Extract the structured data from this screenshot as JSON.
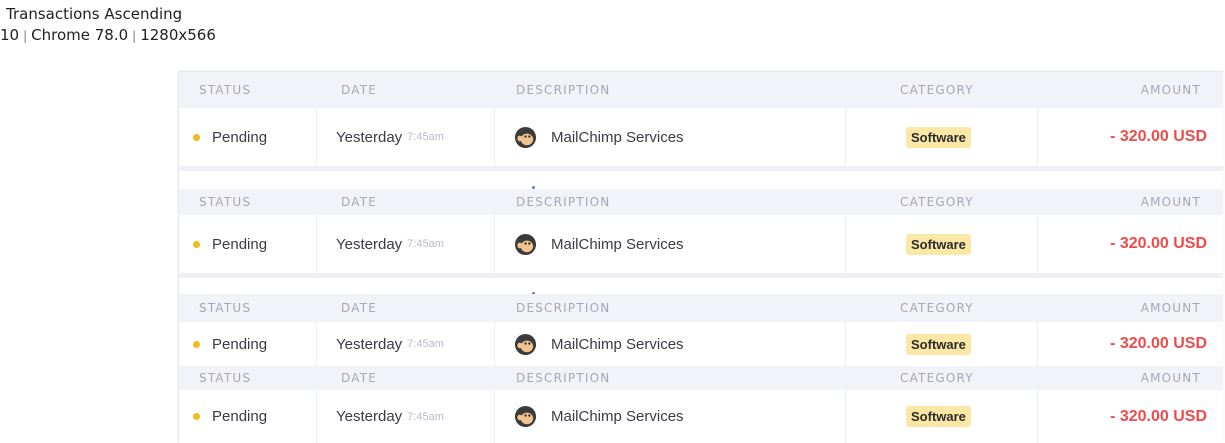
{
  "caption": {
    "title": "Transactions Ascending",
    "platform": "10",
    "browser": "Chrome 78.0",
    "resolution": "1280x566"
  },
  "columns": {
    "status": "STATUS",
    "date": "DATE",
    "description": "DESCRIPTION",
    "category": "CATEGORY",
    "amount": "AMOUNT"
  },
  "rows": [
    {
      "status": "Pending",
      "date": "Yesterday",
      "time": "7:45am",
      "description": "MailChimp Services",
      "category": "Software",
      "amount": "- 320.00 USD"
    },
    {
      "status": "Pending",
      "date": "Yesterday",
      "time": "7:45am",
      "description": "MailChimp Services",
      "category": "Software",
      "amount": "- 320.00 USD"
    },
    {
      "status": "Pending",
      "date": "Yesterday",
      "time": "7:45am",
      "description": "MailChimp Services",
      "category": "Software",
      "amount": "- 320.00 USD"
    },
    {
      "status": "Pending",
      "date": "Yesterday",
      "time": "7:45am",
      "description": "MailChimp Services",
      "category": "Software",
      "amount": "- 320.00 USD"
    }
  ],
  "colors": {
    "pending_dot": "#f6b820",
    "amount": "#ef4b4b",
    "badge_bg": "#fbe8a6",
    "header_bg": "#f2f3f8"
  },
  "icons": {
    "description_logo": "mailchimp-logo-icon"
  }
}
